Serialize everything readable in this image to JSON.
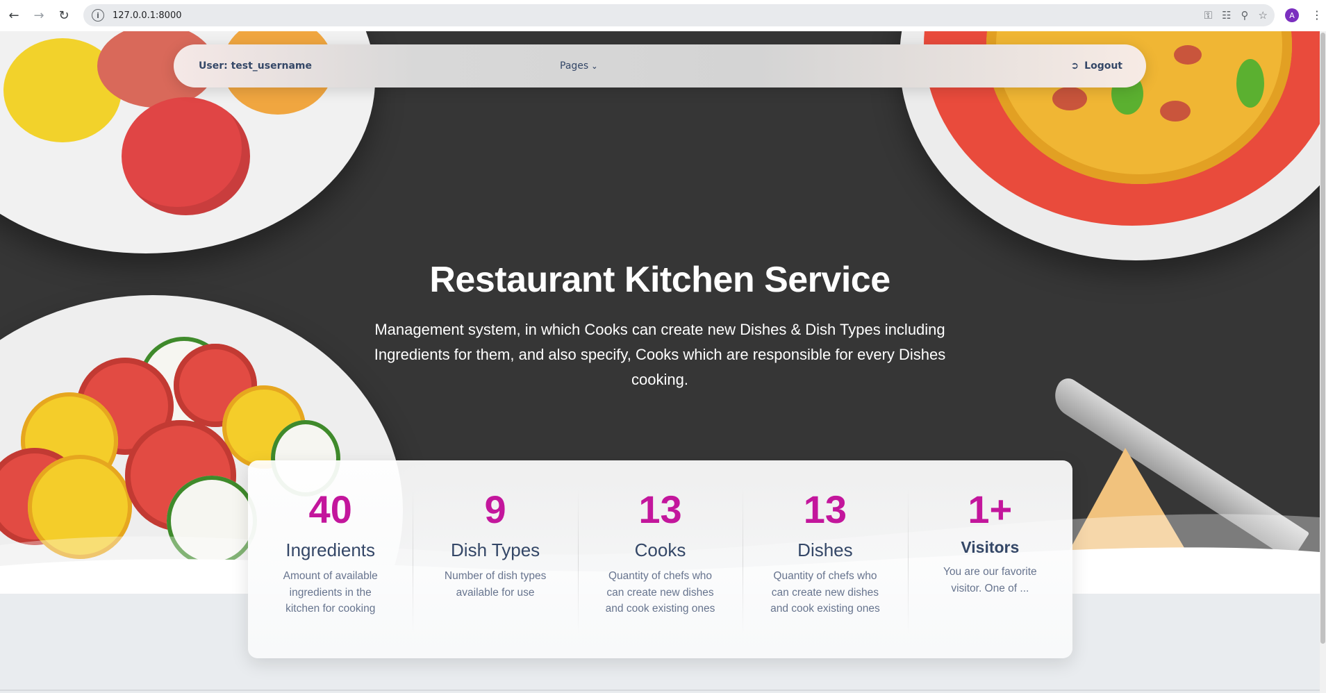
{
  "browser": {
    "url": "127.0.0.1:8000",
    "profile_initial": "A",
    "icons": [
      "back-icon",
      "forward-icon",
      "reload-icon",
      "site-info-icon",
      "password-key-icon",
      "translate-icon",
      "zoom-icon",
      "bookmark-star-icon",
      "menu-kebab-icon"
    ]
  },
  "navbar": {
    "user_label": "User: test_username",
    "pages_label": "Pages",
    "logout_label": "Logout"
  },
  "hero": {
    "title": "Restaurant Kitchen Service",
    "subtitle": "Management system, in which Cooks can create new Dishes & Dish Types including Ingredients for them, and also specify, Cooks which are responsible for every Dishes cooking."
  },
  "stats": [
    {
      "value": "40",
      "label": "Ingredients",
      "description": "Amount of available ingredients in the kitchen for cooking"
    },
    {
      "value": "9",
      "label": "Dish Types",
      "description": "Number of dish types available for use"
    },
    {
      "value": "13",
      "label": "Cooks",
      "description": "Quantity of chefs who can create new dishes and cook existing ones"
    },
    {
      "value": "13",
      "label": "Dishes",
      "description": "Quantity of chefs who can create new dishes and cook existing ones"
    },
    {
      "value": "1+",
      "label": "Visitors",
      "description": "You are our favorite visitor. One of ..."
    }
  ],
  "colors": {
    "accent": "#c3169c",
    "hero_bg": "#363636",
    "text_dark": "#344767",
    "text_muted": "#67748e"
  }
}
